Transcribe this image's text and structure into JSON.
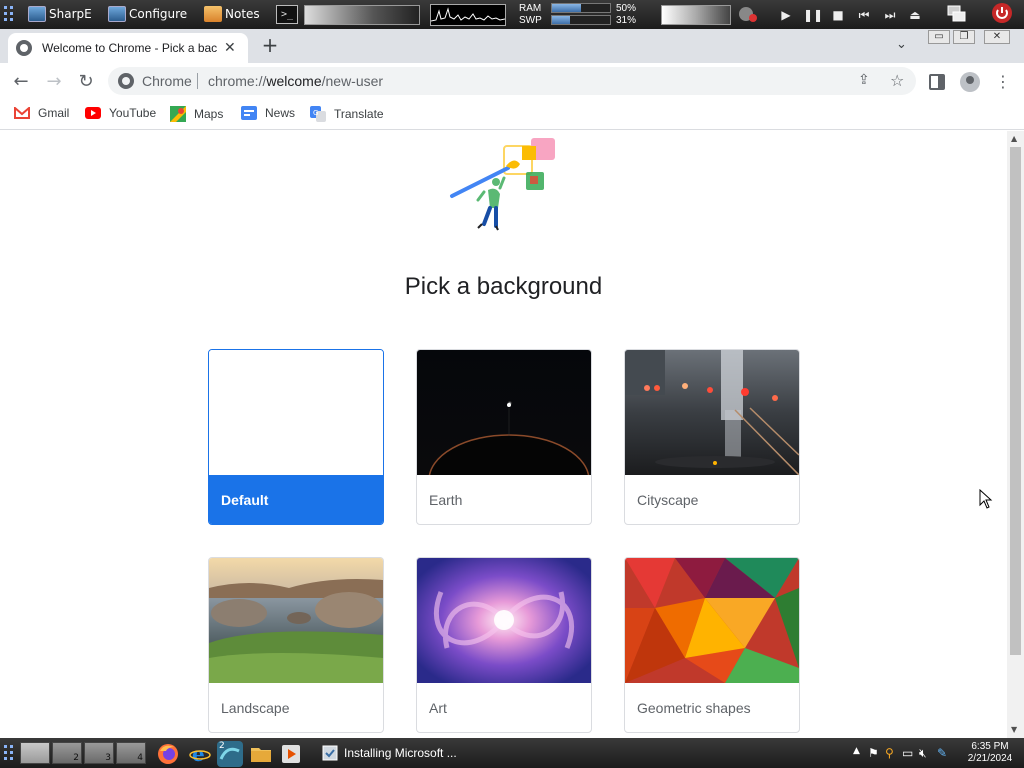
{
  "desktop_panel": {
    "apps": [
      {
        "label": "SharpE",
        "icon": "monitor-icon"
      },
      {
        "label": "Configure",
        "icon": "monitor-icon"
      },
      {
        "label": "Notes",
        "icon": "notes-icon"
      }
    ],
    "terminal_label": ">_",
    "ram_label": "RAM",
    "swp_label": "SWP",
    "ram_percent": "50%",
    "swp_percent": "31%",
    "ram_fraction": 0.5,
    "swp_fraction": 0.31
  },
  "browser": {
    "tab": {
      "title": "Welcome to Chrome - Pick a bac",
      "close": "✕"
    },
    "new_tab": "+",
    "window_controls": {
      "minimize": "▭",
      "restore": "❐",
      "close": "✕"
    },
    "omnibox": {
      "chip": "Chrome",
      "url_host": "chrome://",
      "url_bold": "welcome",
      "url_path": "/new-user"
    },
    "bookmarks": [
      {
        "label": "Gmail",
        "icon": "gmail-icon",
        "color": "#ea4335"
      },
      {
        "label": "YouTube",
        "icon": "youtube-icon",
        "color": "#ff0000"
      },
      {
        "label": "Maps",
        "icon": "maps-icon",
        "color": "#34a853"
      },
      {
        "label": "News",
        "icon": "news-icon",
        "color": "#4285f4"
      },
      {
        "label": "Translate",
        "icon": "translate-icon",
        "color": "#4285f4"
      }
    ]
  },
  "page": {
    "heading": "Pick a background",
    "backgrounds": [
      {
        "label": "Default",
        "selected": true
      },
      {
        "label": "Earth",
        "selected": false
      },
      {
        "label": "Cityscape",
        "selected": false
      },
      {
        "label": "Landscape",
        "selected": false
      },
      {
        "label": "Art",
        "selected": false
      },
      {
        "label": "Geometric shapes",
        "selected": false
      }
    ],
    "accent_color": "#1a73e8"
  },
  "taskbar": {
    "workspaces": [
      "1",
      "2",
      "3",
      "4"
    ],
    "active_workspace": "1",
    "task_window": "Installing Microsoft ...",
    "app_badge": "2",
    "clock_time": "6:35 PM",
    "clock_date": "2/21/2024"
  }
}
